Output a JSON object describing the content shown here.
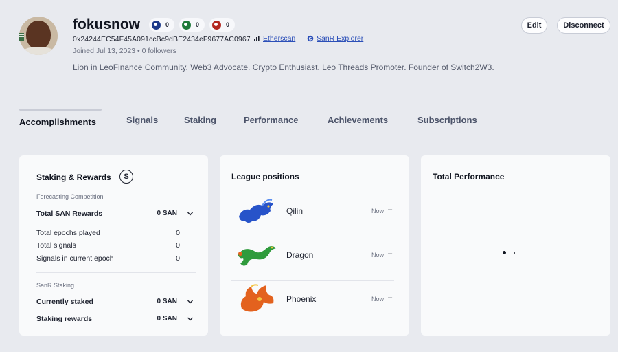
{
  "profile": {
    "username": "fokusnow",
    "address": "0x24244EC54F45A091ccBc9dBE2434eF9677AC0967",
    "etherscan_label": "Etherscan",
    "explorer_label": "SanR Explorer",
    "joined": "Joined Jul 13, 2023 • 0 followers",
    "bio": "Lion in LeoFinance Community. Web3 Advocate. Crypto Enthusiast. Leo Threads Promoter. Founder of Switch2W3.",
    "badges": [
      {
        "count": "0",
        "icon": "blue-league-icon",
        "color": "#1d3a8a"
      },
      {
        "count": "0",
        "icon": "green-league-icon",
        "color": "#1e7a3a"
      },
      {
        "count": "0",
        "icon": "red-league-icon",
        "color": "#b3261e"
      }
    ]
  },
  "header": {
    "edit_label": "Edit",
    "disconnect_label": "Disconnect"
  },
  "tabs": [
    {
      "label": "Accomplishments",
      "active": true
    },
    {
      "label": "Signals",
      "active": false
    },
    {
      "label": "Staking",
      "active": false
    },
    {
      "label": "Performance",
      "active": false
    },
    {
      "label": "Achievements",
      "active": false
    },
    {
      "label": "Subscriptions",
      "active": false
    }
  ],
  "staking_card": {
    "title": "Staking & Rewards",
    "logo_glyph": "S",
    "forecasting_label": "Forecasting Competition",
    "total_rewards_label": "Total SAN Rewards",
    "total_rewards_value": "0 SAN",
    "stats": [
      {
        "label": "Total epochs played",
        "value": "0"
      },
      {
        "label": "Total signals",
        "value": "0"
      },
      {
        "label": "Signals in current epoch",
        "value": "0"
      }
    ],
    "sanr_staking_label": "SanR Staking",
    "currently_staked_label": "Currently staked",
    "currently_staked_value": "0 SAN",
    "staking_rewards_label": "Staking rewards",
    "staking_rewards_value": "0 SAN"
  },
  "league_card": {
    "title": "League positions",
    "leagues": [
      {
        "name": "Qilin",
        "time": "Now",
        "position": "–",
        "icon": "qilin-icon",
        "color": "#2753c9"
      },
      {
        "name": "Dragon",
        "time": "Now",
        "position": "–",
        "icon": "dragon-icon",
        "color": "#2f9b3c"
      },
      {
        "name": "Phoenix",
        "time": "Now",
        "position": "–",
        "icon": "phoenix-icon",
        "color": "#e3621e"
      }
    ]
  },
  "performance_card": {
    "title": "Total Performance"
  }
}
